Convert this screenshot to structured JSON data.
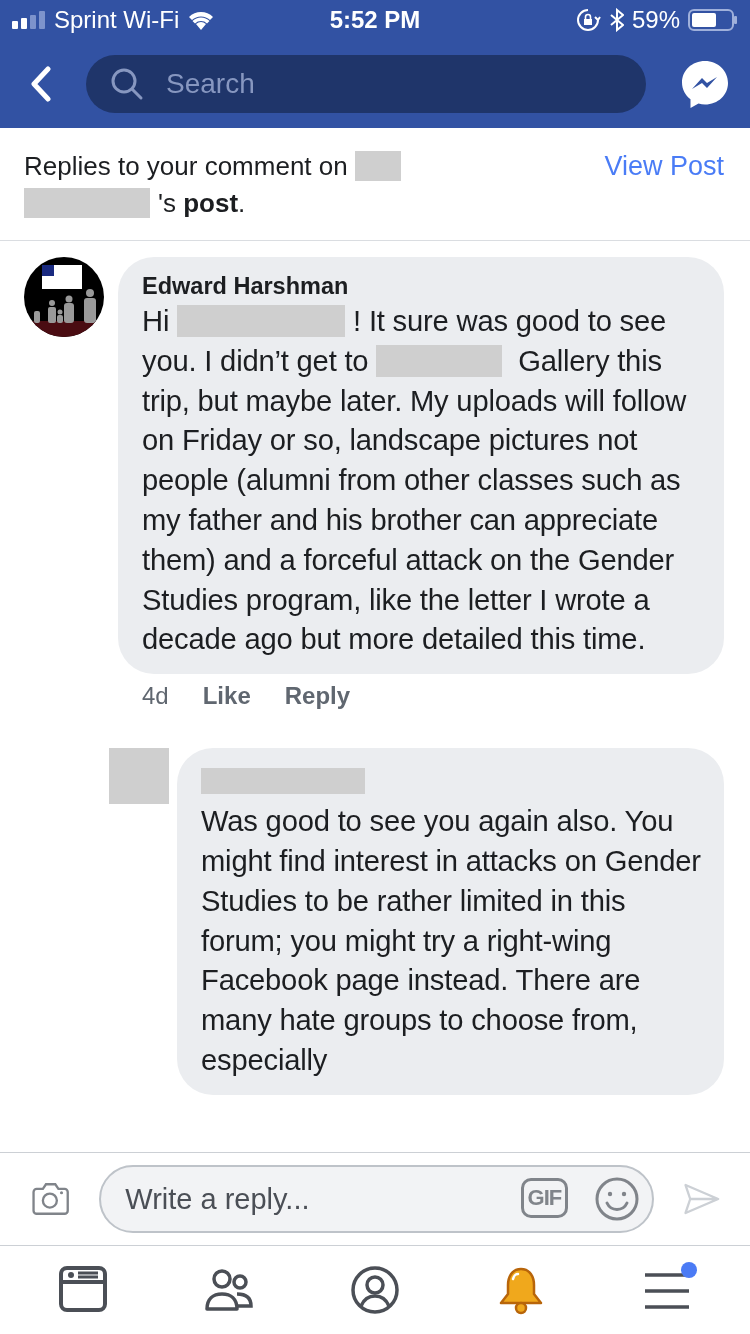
{
  "status_bar": {
    "carrier": "Sprint Wi-Fi",
    "time": "5:52 PM",
    "battery": "59%"
  },
  "nav": {
    "search": {
      "placeholder": "Search"
    }
  },
  "header": {
    "segments": [
      {
        "kind": "text",
        "text": "Replies to your comment on "
      },
      {
        "kind": "blank-short"
      },
      {
        "kind": "blank-medium"
      },
      {
        "kind": "text",
        "text": "'s **post**."
      }
    ],
    "link": "View Post"
  },
  "comments": [
    {
      "kind": "top",
      "author": "Edward Harshman",
      "author_redacted": false,
      "segments": [
        {
          "kind": "text",
          "text": "Hi "
        },
        {
          "kind": "blank-long"
        },
        {
          "kind": "text",
          "text": "! It sure was good to see you. I didn’t get to "
        },
        {
          "kind": "blank-medium"
        },
        {
          "kind": "text",
          "text": " Gallery this trip, but maybe later. My uploads will follow on Friday or so, landscape pictures not people (alumni from other classes such as my father and his brother can appreciate them) and a forceful attack on the Gender Studies program, like the letter I wrote a decade ago but more detailed this time."
        }
      ],
      "time": "4d",
      "actions": [
        "Like",
        "Reply"
      ]
    },
    {
      "kind": "reply",
      "author_redacted": true,
      "avatar": {
        "kind": "redacted"
      },
      "segments": [
        {
          "kind": "text",
          "text": "Was good to see you again also. You might find interest in attacks on Gender Studies to be rather limited in this forum; you might try a right-wing Facebook page instead. There are many hate groups to choose from, especially"
        }
      ]
    }
  ],
  "composer": {
    "placeholder": "Write a reply...",
    "gif": "GIF",
    "send_disabled": true
  },
  "tabs": [
    {
      "kind": "news",
      "selected": false,
      "badge": false
    },
    {
      "kind": "friends",
      "selected": false,
      "badge": false
    },
    {
      "kind": "profile",
      "selected": false,
      "badge": false
    },
    {
      "kind": "notifications",
      "selected": true,
      "badge": false
    },
    {
      "kind": "menu",
      "selected": false,
      "badge": true
    }
  ]
}
